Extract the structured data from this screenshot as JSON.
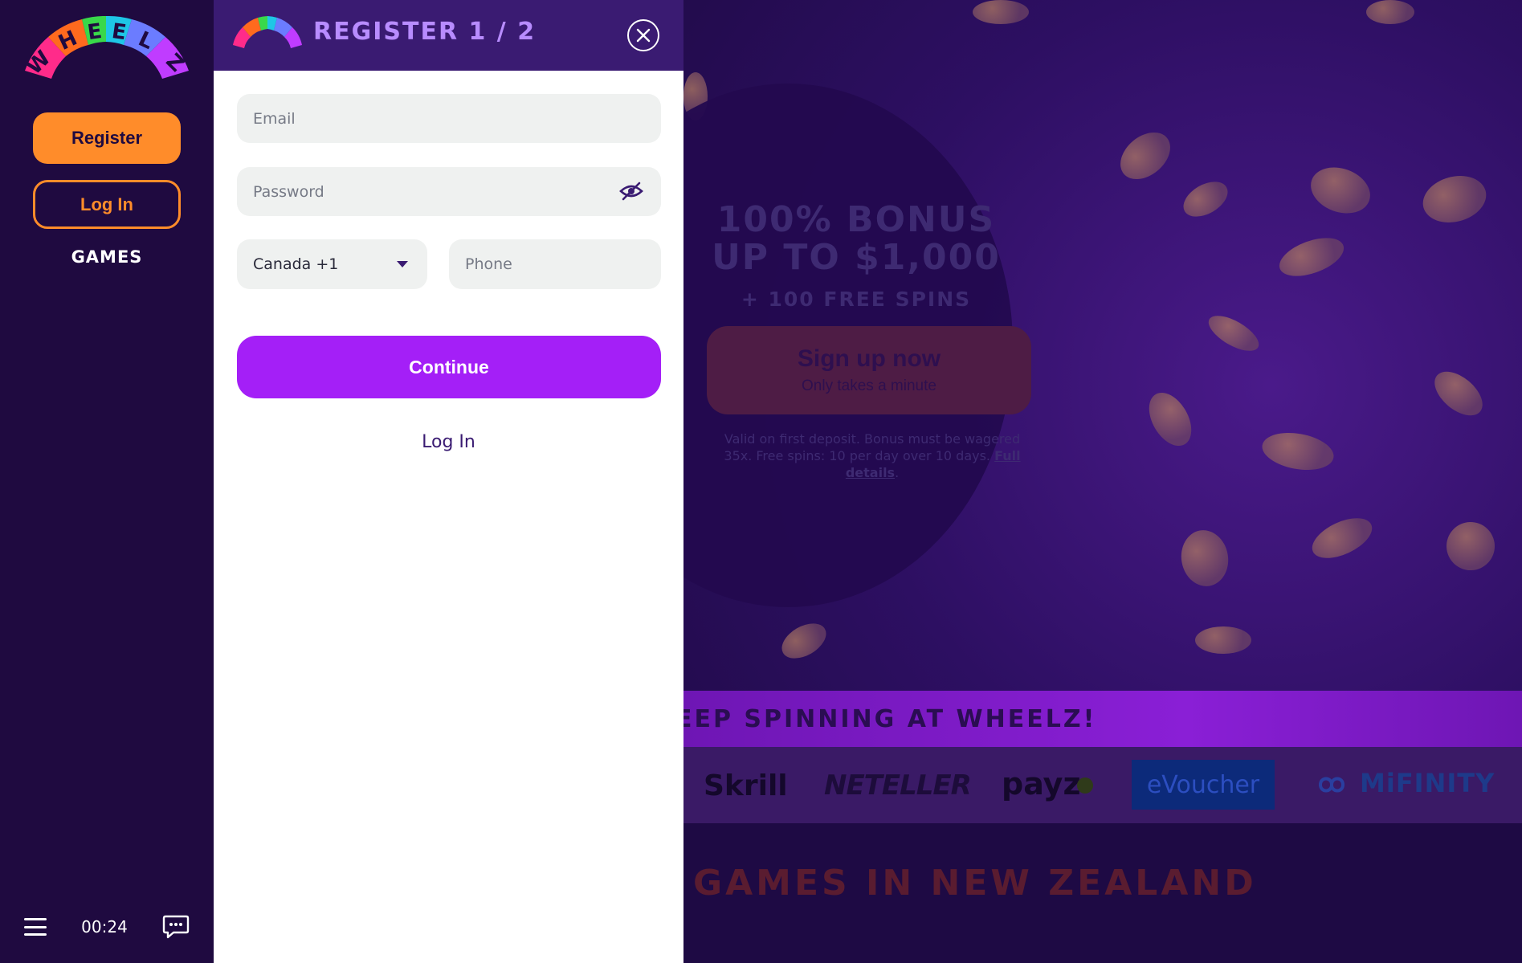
{
  "sidebar": {
    "logo_letters": [
      "W",
      "H",
      "E",
      "E",
      "L",
      "Z"
    ],
    "register_label": "Register",
    "login_label": "Log In",
    "games_label": "GAMES",
    "clock": "00:24"
  },
  "modal": {
    "title": "REGISTER  1 / 2",
    "email_placeholder": "Email",
    "password_placeholder": "Password",
    "country_value": "Canada +1",
    "phone_placeholder": "Phone",
    "continue_label": "Continue",
    "login_link": "Log In"
  },
  "promo": {
    "headline_line1": "100% BONUS",
    "headline_line2": "UP TO $1,000",
    "subline": "+ 100 FREE SPINS",
    "signup_label": "Sign up now",
    "signup_sub": "Only takes a minute",
    "terms_text": "Valid on first deposit. Bonus must be wagered 35x. Free spins: 10 per day over 10 days.",
    "terms_link": "Full details",
    "band_text": "EEP SPINNING AT WHEELZ!",
    "games_heading": "GAMES IN NEW ZEALAND"
  },
  "payments": {
    "skrill": "Skrill",
    "neteller": "NETELLER",
    "payz": "payz",
    "evoucher": "eVoucher",
    "mifinity": "MiFINITY"
  },
  "colors": {
    "sidebar_bg": "#1f0a40",
    "accent_orange": "#ff8c2a",
    "continue_purple": "#a41ff7",
    "header_purple": "#3a1b72"
  },
  "icons": [
    "close-icon",
    "eye-slash-icon",
    "chevron-down-icon",
    "menu-icon",
    "chat-icon"
  ]
}
